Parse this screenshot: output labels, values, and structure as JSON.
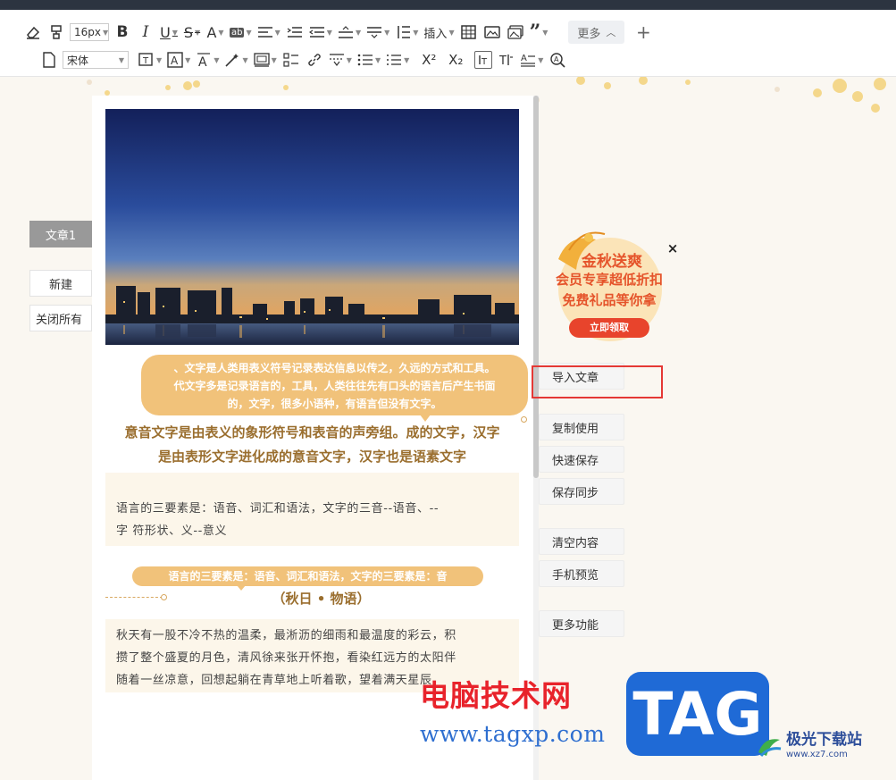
{
  "toolbar": {
    "font_size_value": "16px",
    "font_family_value": "宋体",
    "insert_label": "插入",
    "more_label": "更多",
    "superscript_label": "X²",
    "subscript_label": "X₂",
    "row1_icons": [
      "eraser-icon",
      "format-painter-icon",
      "font-size-select",
      "bold-icon",
      "italic-icon",
      "underline-icon",
      "strikethrough-icon",
      "font-color-icon",
      "background-color-icon",
      "align-icon",
      "indent-icon",
      "outdent-icon",
      "line-height-icon",
      "paragraph-spacing-icon",
      "letter-spacing-icon",
      "insert-menu",
      "table-icon",
      "image-icon",
      "gallery-icon",
      "quote-icon",
      "more-button",
      "plus-icon"
    ],
    "row2_icons": [
      "page-icon",
      "font-family-select",
      "text-box-icon",
      "border-text-icon",
      "font-effect-icon",
      "magic-wand-icon",
      "frame-icon",
      "list-icon",
      "link-icon",
      "divider-icon",
      "ordered-list-icon",
      "unordered-list-icon",
      "superscript-icon",
      "subscript-icon",
      "first-line-indent-icon",
      "justify-icon",
      "text-direction-icon",
      "find-icon"
    ]
  },
  "left_panel": {
    "tab_label": "文章1",
    "new_label": "新建",
    "close_all_label": "关闭所有"
  },
  "document": {
    "bubble1_lines": [
      "、文字是人类用表义符号记录表达信息以传之，久远的方式和工具。",
      "代文字多是记录语言的，工具，人类往往先有口头的语言后产生书面",
      "的，文字，很多小语种，有语言但没有文字。"
    ],
    "heading_lines": [
      "意音文字是由表义的象形符号和表音的声旁组。成的文字，汉字",
      "是由表形文字进化成的意音文字，汉字也是语素文字"
    ],
    "para1_lines": [
      "语言的三要素是：语音、词汇和语法，文字的三音--语音、--",
      "字 符形状、义--意义"
    ],
    "bubble2_text": "语言的三要素是：语音、词汇和语法，文字的三要素是：音",
    "subheading": "（秋日 • 物语）",
    "para2_lines": [
      "秋天有一股不冷不热的温柔，最淅沥的细雨和最温度的彩云，积",
      "攒了整个盛夏的月色，清风徐来张开怀抱，看染红远方的太阳伴",
      "随着一丝凉意，回想起躺在青草地上听着歌，望着满天星辰"
    ]
  },
  "ad": {
    "line1": "金秋送爽",
    "line2": "会员专享超低折扣",
    "line3": "免费礼品等你拿",
    "button": "立即领取",
    "close_symbol": "×"
  },
  "right_panel": {
    "import_label": "导入文章",
    "copy_label": "复制使用",
    "quick_save_label": "快速保存",
    "save_sync_label": "保存同步",
    "clear_label": "清空内容",
    "preview_label": "手机预览",
    "more_label": "更多功能"
  },
  "watermark": {
    "site_name": "电脑技术网",
    "url": "www.tagxp.com",
    "tag": "TAG",
    "jg_name": "极光下载站",
    "jg_url": "www.xz7.com"
  },
  "colors": {
    "bubble": "#f1c27a",
    "heading": "#9a6e2e",
    "highlight": "#e53935",
    "watermark_red": "#e8232b",
    "watermark_blue": "#1f6ad6"
  }
}
